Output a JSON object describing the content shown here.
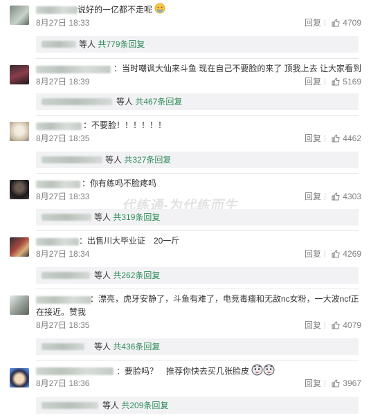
{
  "watermark": "代练通-为代练而生",
  "labels": {
    "reply": "回复",
    "people_suffix": "等人",
    "reply_suffix": "条回复",
    "total_prefix": "共"
  },
  "comments": [
    {
      "text": "说好的一亿都不走呢",
      "date": "8月27日 18:33",
      "likes": "4709",
      "sub_total": "共779条回复"
    },
    {
      "text": "：当时嘲讽大仙来斗鱼 现在自己不要脸的来了 顶我上去 让大家看到",
      "date": "8月27日 18:39",
      "likes": "5169",
      "sub_total": "共467条回复"
    },
    {
      "text": "：不要脸！！！！！！",
      "date": "8月27日 18:35",
      "likes": "4462",
      "sub_total": "共327条回复"
    },
    {
      "text": "：你有练吗不脸疼吗",
      "date": "8月27日 18:33",
      "likes": "4303",
      "sub_total": "共319条回复"
    },
    {
      "text": "：出售川大毕业证　20一斤",
      "date": "8月27日 18:34",
      "likes": "4269",
      "sub_total": "共262条回复"
    },
    {
      "text": "：漂亮，虎牙安静了，斗鱼有难了，电竞毒瘤和无敌nc女粉，一大波ncf正在接近。赞我",
      "date": "8月27日 18:35",
      "likes": "4079",
      "sub_total": "共436条回复"
    },
    {
      "text": "：要脸吗？　推荐你快去买几张脸皮",
      "date": "8月27日 18:36",
      "likes": "3967",
      "sub_total": "共209条回复"
    }
  ]
}
